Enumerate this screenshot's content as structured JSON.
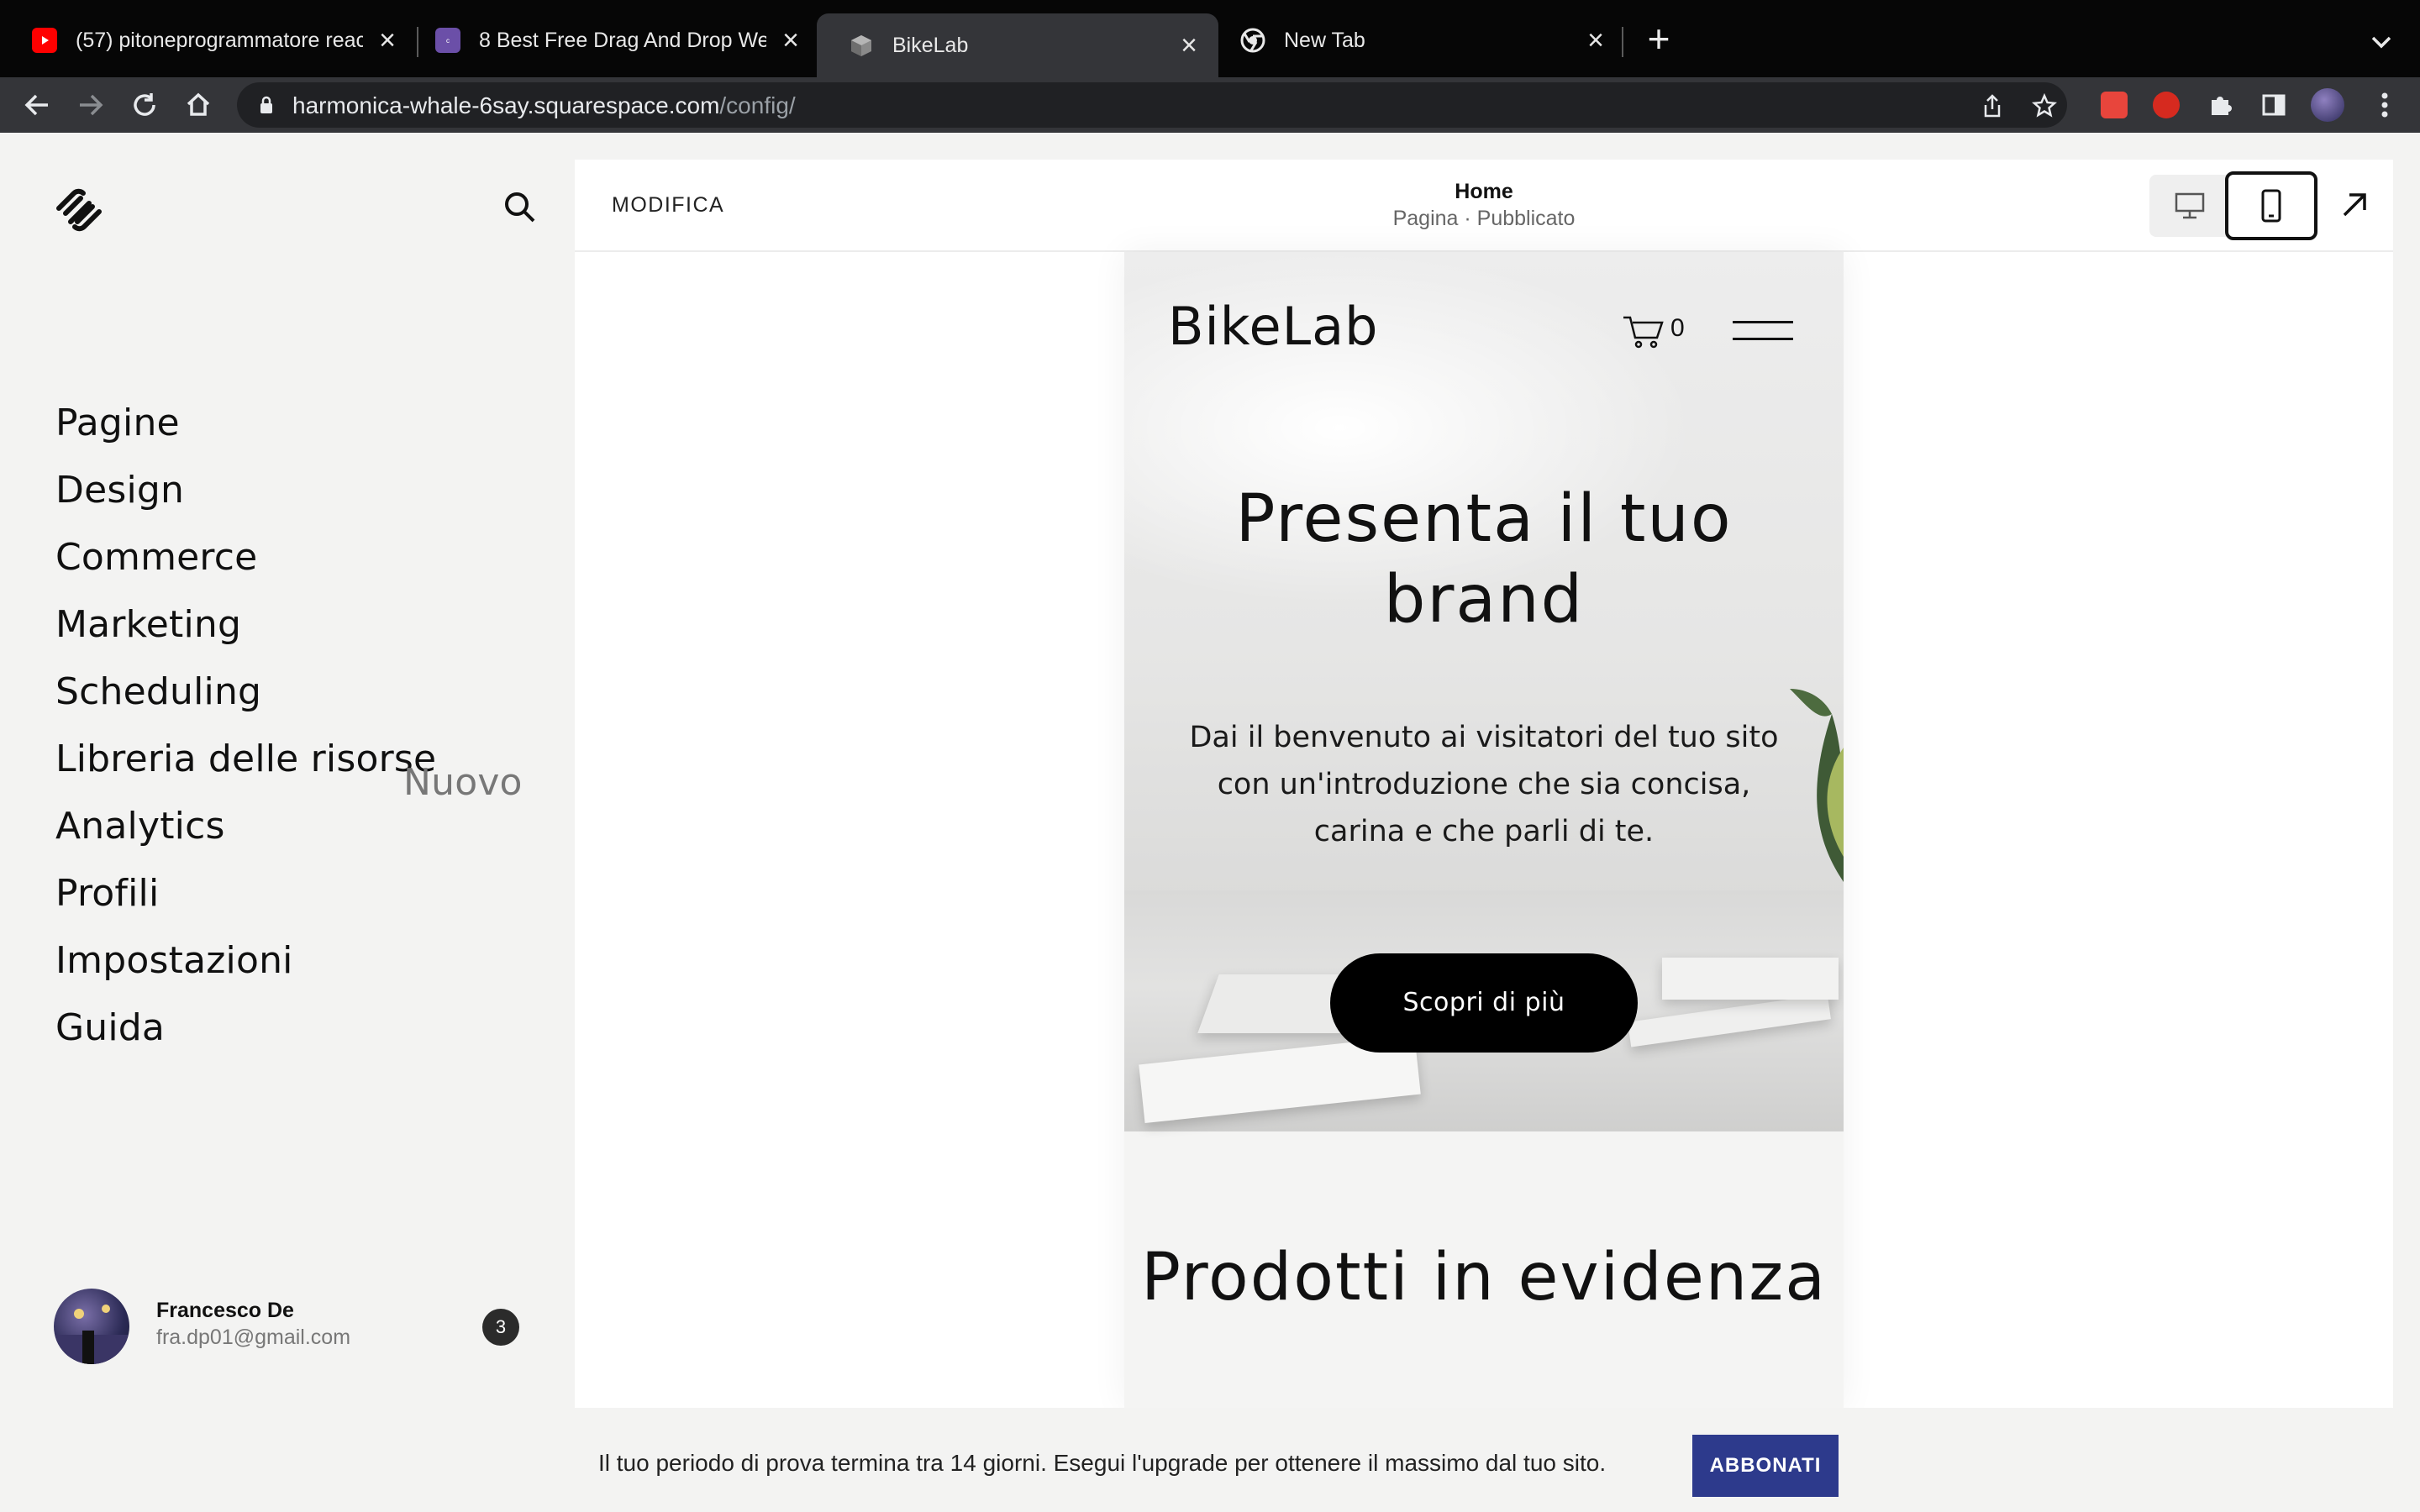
{
  "browser": {
    "tabs": [
      {
        "title": "(57) pitoneprogrammatore reac",
        "icon": "youtube-icon"
      },
      {
        "title": "8 Best Free Drag And Drop We",
        "icon": "colorlib-icon"
      },
      {
        "title": "BikeLab",
        "icon": "cube-icon"
      },
      {
        "title": "New Tab",
        "icon": "chrome-icon"
      }
    ],
    "url_host": "harmonica-whale-6say.squarespace.com",
    "url_path": "/config/"
  },
  "sidebar": {
    "items": [
      {
        "label": "Pagine"
      },
      {
        "label": "Design"
      },
      {
        "label": "Commerce"
      },
      {
        "label": "Marketing"
      },
      {
        "label": "Scheduling"
      },
      {
        "label": "Libreria delle risorse",
        "badge": "Nuovo"
      },
      {
        "label": "Analytics"
      },
      {
        "label": "Profili"
      },
      {
        "label": "Impostazioni"
      },
      {
        "label": "Guida"
      }
    ],
    "user": {
      "name": "Francesco De",
      "email": "fra.dp01@gmail.com",
      "notifications": "3"
    }
  },
  "editor": {
    "edit_label": "MODIFICA",
    "page_title": "Home",
    "page_status": "Pagina · Pubblicato"
  },
  "site": {
    "brand": "BikeLab",
    "cart_count": "0",
    "headline": "Presenta il tuo brand",
    "intro": "Dai il benvenuto ai visitatori del tuo sito con un'introduzione che sia concisa, carina e che parli di te.",
    "cta": "Scopri di più",
    "section_title": "Prodotti in evidenza"
  },
  "trial": {
    "message": "Il tuo periodo di prova termina tra 14 giorni. Esegui l'upgrade per ottenere il massimo dal tuo sito.",
    "button": "ABBONATI"
  },
  "colors": {
    "accent": "#2d3a8c",
    "tabbar": "#060606",
    "toolbar": "#343539"
  }
}
